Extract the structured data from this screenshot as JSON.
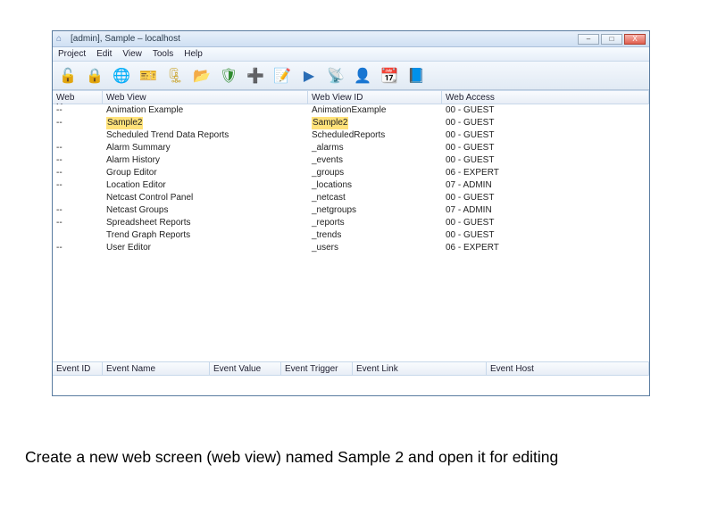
{
  "window": {
    "title": "[admin], Sample – localhost",
    "buttons": {
      "min": "–",
      "max": "□",
      "close": "X"
    }
  },
  "menu": [
    "Project",
    "Edit",
    "View",
    "Tools",
    "Help"
  ],
  "toolbar_icons": [
    {
      "name": "unlock-icon",
      "glyph": "🔓",
      "cls": "orange"
    },
    {
      "name": "lock-icon",
      "glyph": "🔒",
      "cls": "orange"
    },
    {
      "name": "open-globe-icon",
      "glyph": "🌐",
      "cls": "green"
    },
    {
      "name": "open-ticket-icon",
      "glyph": "🎫",
      "cls": "blue"
    },
    {
      "name": "zip-icon",
      "glyph": "🗜",
      "cls": "yellow"
    },
    {
      "name": "folder-icon",
      "glyph": "📂",
      "cls": "yellow"
    },
    {
      "name": "shield-icon",
      "glyph": "🛡",
      "cls": "green"
    },
    {
      "name": "add-icon",
      "glyph": "➕",
      "cls": "green"
    },
    {
      "name": "edit-note-icon",
      "glyph": "📝",
      "cls": "blue"
    },
    {
      "name": "play-icon",
      "glyph": "▶",
      "cls": "blue"
    },
    {
      "name": "antenna-icon",
      "glyph": "📡",
      "cls": "blue"
    },
    {
      "name": "user-icon",
      "glyph": "👤",
      "cls": "orange"
    },
    {
      "name": "calendar-icon",
      "glyph": "📆",
      "cls": "blue"
    },
    {
      "name": "book-icon",
      "glyph": "📘",
      "cls": "purple"
    }
  ],
  "columns": {
    "webusers": "Web Users",
    "webview": "Web View",
    "webid": "Web View ID",
    "webaccess": "Web Access"
  },
  "rows": [
    {
      "users": "--",
      "view": "Animation Example",
      "id": "AnimationExample",
      "access": "00 - GUEST",
      "hl": false
    },
    {
      "users": "--",
      "view": "Sample2",
      "id": "Sample2",
      "access": "00 - GUEST",
      "hl": true
    },
    {
      "users": "",
      "view": "Scheduled Trend Data Reports",
      "id": "ScheduledReports",
      "access": "00 - GUEST",
      "hl": false
    },
    {
      "users": "--",
      "view": "Alarm Summary",
      "id": "_alarms",
      "access": "00 - GUEST",
      "hl": false
    },
    {
      "users": "--",
      "view": "Alarm History",
      "id": "_events",
      "access": "00 - GUEST",
      "hl": false
    },
    {
      "users": "--",
      "view": "Group Editor",
      "id": "_groups",
      "access": "06 - EXPERT",
      "hl": false
    },
    {
      "users": "--",
      "view": "Location Editor",
      "id": "_locations",
      "access": "07 - ADMIN",
      "hl": false
    },
    {
      "users": "",
      "view": "Netcast Control Panel",
      "id": "_netcast",
      "access": "00 - GUEST",
      "hl": false
    },
    {
      "users": "--",
      "view": "Netcast Groups",
      "id": "_netgroups",
      "access": "07 - ADMIN",
      "hl": false
    },
    {
      "users": "--",
      "view": "Spreadsheet Reports",
      "id": "_reports",
      "access": "00 - GUEST",
      "hl": false
    },
    {
      "users": "",
      "view": "Trend Graph Reports",
      "id": "_trends",
      "access": "00 - GUEST",
      "hl": false
    },
    {
      "users": "--",
      "view": "User Editor",
      "id": "_users",
      "access": "06 - EXPERT",
      "hl": false
    }
  ],
  "bottom_columns": [
    "Event ID",
    "Event Name",
    "Event Value",
    "Event Trigger",
    "Event Link",
    "Event Host"
  ],
  "caption": "Create a new web screen (web view) named Sample 2 and open it for editing"
}
